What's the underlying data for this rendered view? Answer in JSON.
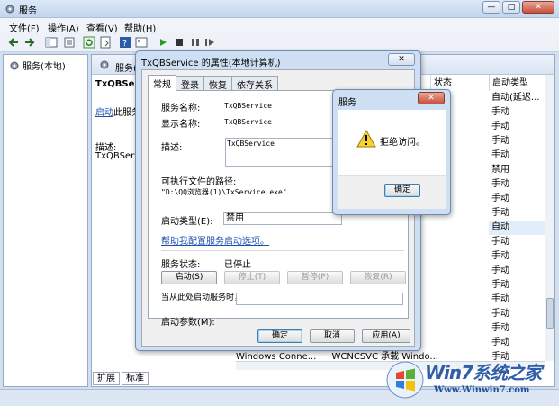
{
  "window": {
    "title": "服务",
    "buttons": [
      "—",
      "□",
      "✕"
    ]
  },
  "menu": [
    "文件(F)",
    "操作(A)",
    "查看(V)",
    "帮助(H)"
  ],
  "tree": {
    "root": "服务(本地)"
  },
  "content": {
    "header": "服务(本地)",
    "service_name": "TxQBServi",
    "start_link": "启动",
    "start_link_suffix": "此服务",
    "desc_label": "描述:",
    "desc_value": "TxQBServi",
    "col_status": "状态",
    "col_startup": "启动类型",
    "startup_rows": [
      "自动(延迟...",
      "手动",
      "手动",
      "手动",
      "手动",
      "禁用",
      "手动",
      "手动",
      "手动",
      "自动",
      "手动",
      "手动",
      "手动",
      "手动",
      "手动",
      "手动",
      "手动",
      "手动",
      "手动",
      "手动"
    ],
    "selected_index": 9,
    "bottom_row_name": "Windows Conne...",
    "bottom_row_desc": "WCNCSVC 承载 Windo..."
  },
  "bottom_tabs": [
    "扩展",
    "标准"
  ],
  "props": {
    "title": "TxQBService 的属性(本地计算机)",
    "close": "✕",
    "tabs": [
      "常规",
      "登录",
      "恢复",
      "依存关系"
    ],
    "service_name_label": "服务名称:",
    "service_name_value": "TxQBService",
    "display_name_label": "显示名称:",
    "display_name_value": "TxQBService",
    "desc_label": "描述:",
    "desc_value": "TxQBService",
    "path_label": "可执行文件的路径:",
    "path_value": "\"D:\\QQ浏览器(1)\\TxService.exe\"",
    "startup_type_label": "启动类型(E):",
    "startup_type_value": "禁用",
    "help_link": "帮助我配置服务启动选项。",
    "status_label": "服务状态:",
    "status_value": "已停止",
    "btn_start": "启动(S)",
    "btn_stop": "停止(T)",
    "btn_pause": "暂停(P)",
    "btn_resume": "恢复(R)",
    "params_hint": "当从此处启动服务时，您可指定所适用的启动参数。",
    "params_label": "启动参数(M):",
    "btn_ok": "确定",
    "btn_cancel": "取消",
    "btn_apply": "应用(A)"
  },
  "msgbox": {
    "title": "服务",
    "close": "✕",
    "text": "拒绝访问。",
    "ok": "确定"
  },
  "watermark": {
    "main": "Win7系统之家",
    "url": "Www.Winwin7.com"
  }
}
